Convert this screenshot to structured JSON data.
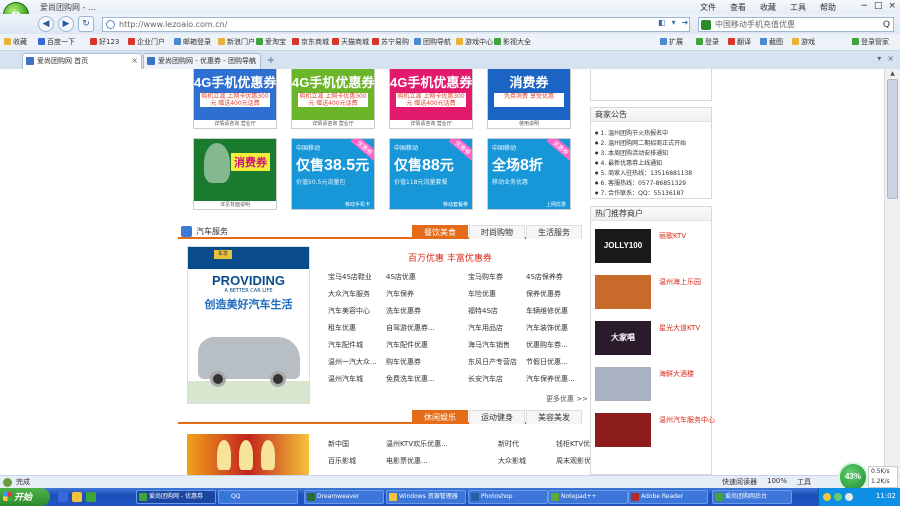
{
  "window": {
    "title": "爱尚团购网 - ...",
    "menu": [
      "文件",
      "查看",
      "收藏",
      "工具",
      "帮助"
    ]
  },
  "navbar": {
    "back_icon": "back-arrow-icon",
    "forward_icon": "forward-arrow-icon",
    "refresh_icon": "refresh-icon",
    "home_icon": "home-icon",
    "address_value": "http://www.lezoaio.com.cn/",
    "search_value": "中国移动手机充值优惠",
    "search_button": "Q"
  },
  "favorites": [
    {
      "label": "收藏",
      "color": "#e8b237"
    },
    {
      "label": "百度一下",
      "color": "#3b68d8"
    },
    {
      "label": "好123",
      "color": "#d9332b"
    },
    {
      "label": "企业门户",
      "color": "#d9332b"
    },
    {
      "label": "邮箱登录",
      "color": "#4a8ad0"
    },
    {
      "label": "新浪门户",
      "color": "#e8b237"
    },
    {
      "label": "爱淘宝",
      "color": "#3fa43a"
    },
    {
      "label": "京东商城",
      "color": "#d9332b"
    },
    {
      "label": "天猫商城",
      "color": "#d9332b"
    },
    {
      "label": "苏宁易购",
      "color": "#d9332b"
    },
    {
      "label": "团购导航",
      "color": "#4a8ad0"
    },
    {
      "label": "游戏中心",
      "color": "#e8b237"
    },
    {
      "label": "影视大全",
      "color": "#3fa43a"
    }
  ],
  "favbar_right": [
    {
      "label": "扩展",
      "color": "#4a8ad0"
    },
    {
      "label": "登录",
      "color": "#3fa43a"
    },
    {
      "label": "翻译",
      "color": "#d9332b"
    },
    {
      "label": "截图",
      "color": "#4a8ad0"
    },
    {
      "label": "游戏",
      "color": "#e8b237"
    },
    {
      "label": "登录管家",
      "color": "#3fa43a"
    }
  ],
  "tabs": [
    {
      "label": "爱尚团购网 首页"
    },
    {
      "label": "爱尚团购网 - 优惠券 - 团购导航"
    }
  ],
  "coupons_row1": [
    {
      "title": "4G手机优惠券",
      "bg": "#2e6fd0",
      "sub": "购机立减 上网卡优惠300元 赠送400元话费",
      "foot": "详情请咨询 营业厅"
    },
    {
      "title": "4G手机优惠券",
      "bg": "#6bb52a",
      "sub": "购机立减 上网卡优惠300元 赠送400元话费",
      "foot": "详情请咨询 营业厅"
    },
    {
      "title": "4G手机优惠券",
      "bg": "#e21a6e",
      "sub": "购机立减 上网卡优惠300元 赠送400元话费",
      "foot": "详情请咨询 营业厅"
    },
    {
      "title": "消费券",
      "bg": "#1b64c4",
      "sub": "凭券消费 享受优惠",
      "foot": "使用说明"
    }
  ],
  "coupons_row2": [
    {
      "kind": "voucher",
      "title": "消费券",
      "bg": "#1a7a2e",
      "foot": "详见背面说明"
    },
    {
      "kind": "mobile",
      "badge": "中国移动",
      "price_prefix": "仅售",
      "price": "38.5",
      "unit": "元",
      "desc": "价值50.5元流量包",
      "tag": "优惠券",
      "foot": "移动手机卡",
      "bg": "#1796d8"
    },
    {
      "kind": "mobile",
      "badge": "中国移动",
      "price_prefix": "仅售",
      "price": "88",
      "unit": "元",
      "desc": "价值118元流量套餐",
      "tag": "优惠券",
      "foot": "移动套餐券",
      "bg": "#1796d8"
    },
    {
      "kind": "mobile",
      "badge": "中国移动",
      "price_prefix": "全场",
      "price": "8",
      "unit": "折",
      "desc": "移动业务优惠",
      "tag": "优惠券",
      "foot": "上网优惠",
      "bg": "#1796d8"
    }
  ],
  "section_auto": {
    "title": "汽车服务",
    "tabs": [
      "餐饮美食",
      "时尚购物",
      "生活服务"
    ],
    "promo_head": "百万优惠 丰富优惠券",
    "ad": {
      "badge": "车享",
      "h1": "PROVIDING",
      "h2": "A BETTER CAR LIFE",
      "h3": "创造美好汽车生活"
    },
    "deals": [
      [
        "宝马4S店鞋业",
        "4S店优惠",
        "宝马购车券",
        "4S店保养券"
      ],
      [
        "大众汽车服务",
        "汽车保养",
        "车险优惠",
        "保养优惠券"
      ],
      [
        "汽车美容中心",
        "洗车优惠券",
        "福特4S店",
        "车辆维修优惠"
      ],
      [
        "租车优惠",
        "自驾游优惠券...",
        "汽车用品店",
        "汽车装饰优惠"
      ],
      [
        "汽车配件城",
        "汽车配件优惠",
        "海马汽车销售",
        "优惠购车券..."
      ],
      [
        "温州一汽大众...",
        "购车优惠券",
        "东风日产专营店",
        "节假日优惠..."
      ],
      [
        "温州汽车城",
        "免费洗车优惠...",
        "长安汽车店",
        "汽车保养优惠..."
      ]
    ],
    "more": "更多优惠 >>"
  },
  "section_leisure": {
    "title": "休闲娱乐",
    "tabs": [
      "休闲娱乐",
      "运动健身",
      "美容美发"
    ],
    "rows": [
      [
        "新中国",
        "温州KTV欢乐优惠...",
        "新时代",
        "钱柜KTV优惠..."
      ],
      [
        "百乐影城",
        "电影票优惠...",
        "大众影城",
        "周末观影优惠..."
      ]
    ]
  },
  "notice_panel": {
    "title": "商家公告",
    "items": [
      "1. 温州团购节火热报名中",
      "2. 温州团购网二期招商正式开始",
      "3. 本周团购活动安排通知",
      "4. 最新优惠券上线通知",
      "5. 商家入驻热线：13516881138",
      "6. 客服热线：0577-86851329",
      "7. 合作联系：QQ：55136187"
    ]
  },
  "merchant_panel": {
    "title": "热门推荐商户",
    "items": [
      {
        "name": "丽歌KTV",
        "thumb_text": "JOLLY100",
        "thumb_color": "#1a1a1a"
      },
      {
        "name": "温州海上乐园",
        "thumb_text": "",
        "thumb_color": "#c96a2a"
      },
      {
        "name": "星光大道KTV",
        "thumb_text": "大家唱",
        "thumb_color": "#2a1a2a"
      },
      {
        "name": "海鲜大酒楼",
        "thumb_text": "",
        "thumb_color": "#a8b2c0"
      },
      {
        "name": "温州汽车服务中心",
        "thumb_text": "",
        "thumb_color": "#8d1c1c"
      }
    ]
  },
  "statusbar": {
    "left": "完成",
    "right": [
      "快速阅读器",
      "100%",
      "工具"
    ]
  },
  "speed": {
    "value": "43%",
    "up": "0.5K/s",
    "down": "1.2K/s"
  },
  "taskbar": {
    "start": "开始",
    "tasks": [
      {
        "label": "爱尚团购网 - 优惠券",
        "color": "#3fa43a",
        "active": true
      },
      {
        "label": "QQ",
        "color": "#2c7bd8",
        "active": false
      },
      {
        "label": "Dreamweaver",
        "color": "#2a6a33",
        "active": false
      },
      {
        "label": "Windows 资源管理器",
        "color": "#f3c43a",
        "active": false
      },
      {
        "label": "Photoshop",
        "color": "#2b5ea8",
        "active": false
      },
      {
        "label": "Notepad++",
        "color": "#5fa83a",
        "active": false
      },
      {
        "label": "Adobe Reader",
        "color": "#b22b2b",
        "active": false
      },
      {
        "label": "爱尚团购网后台",
        "color": "#3fa43a",
        "active": false
      }
    ],
    "clock": "11:02"
  }
}
